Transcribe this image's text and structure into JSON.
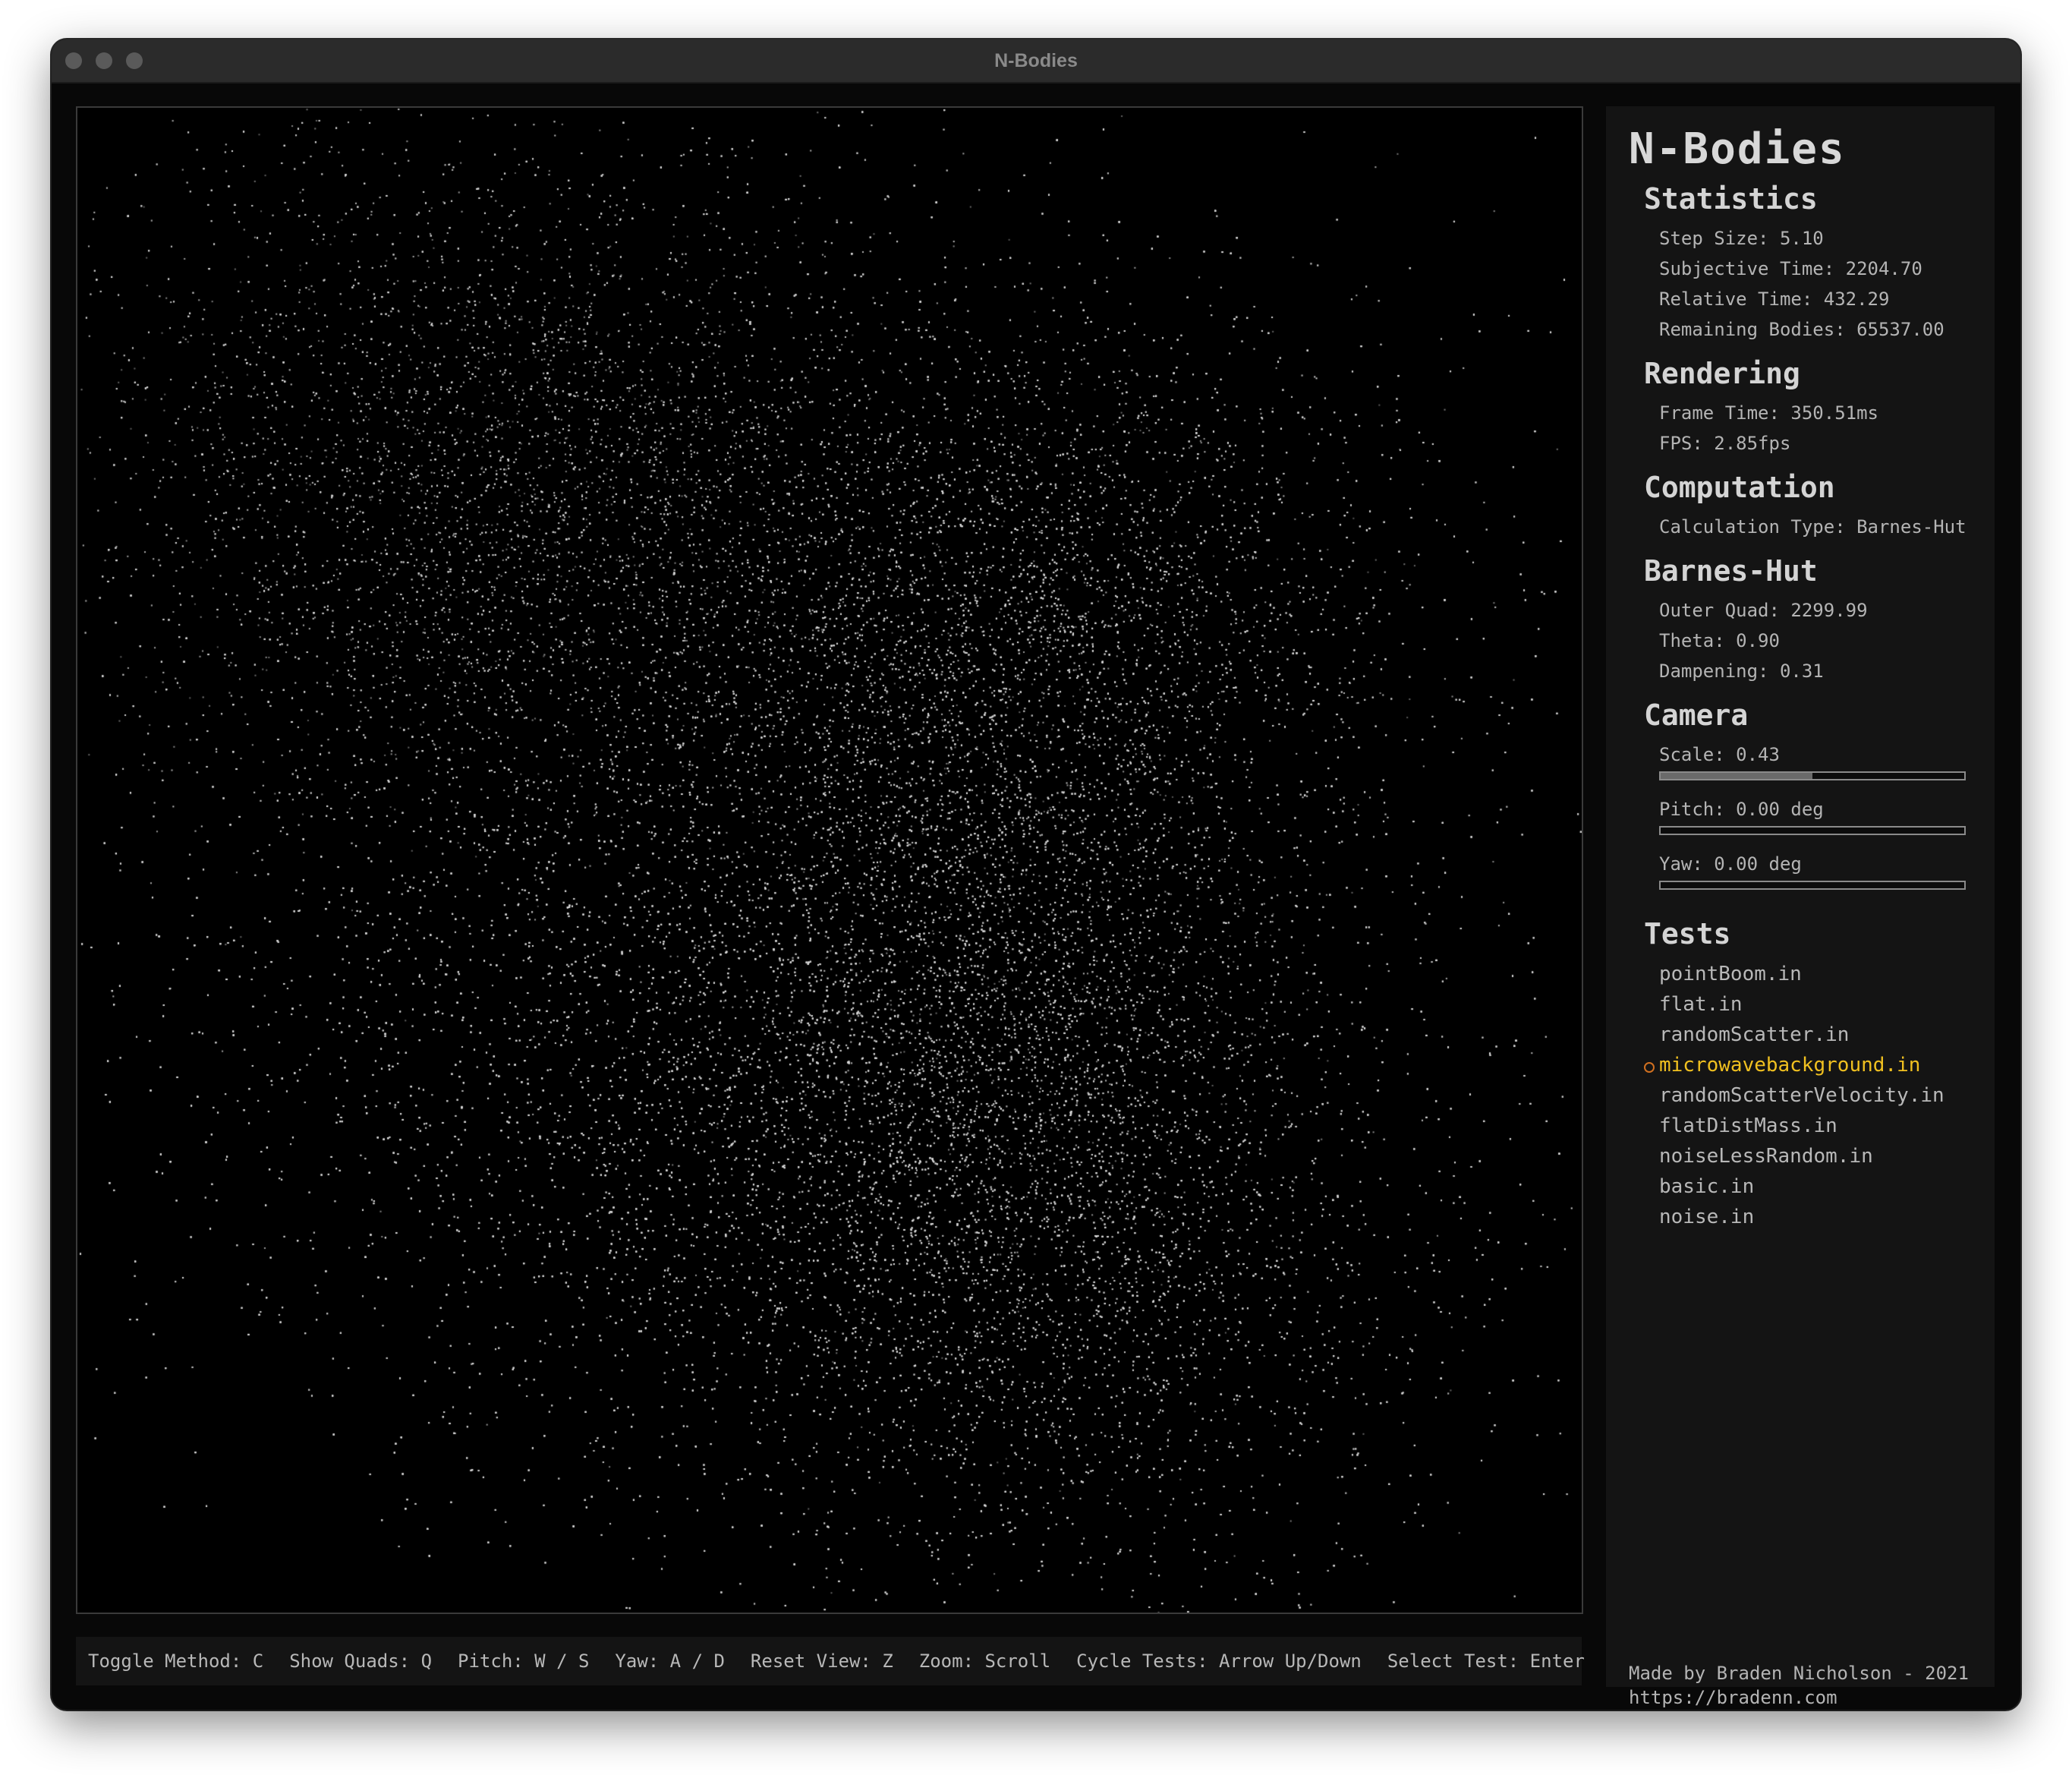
{
  "window": {
    "title": "N-Bodies"
  },
  "hotkeys": [
    "Toggle Method: C",
    "Show Quads: Q",
    "Pitch: W / S",
    "Yaw: A / D",
    "Reset View: Z",
    "Zoom: Scroll",
    "Cycle Tests: Arrow Up/Down",
    "Select Test: Enter"
  ],
  "sidebar": {
    "title": "N-Bodies",
    "statistics": {
      "heading": "Statistics",
      "step_size": "Step Size: 5.10",
      "subjective_time": "Subjective Time: 2204.70",
      "relative_time": "Relative Time: 432.29",
      "remaining_bodies": "Remaining Bodies: 65537.00"
    },
    "rendering": {
      "heading": "Rendering",
      "frame_time": "Frame Time: 350.51ms",
      "fps": "FPS: 2.85fps"
    },
    "computation": {
      "heading": "Computation",
      "calculation_type": "Calculation Type: Barnes-Hut"
    },
    "barnes_hut": {
      "heading": "Barnes-Hut",
      "outer_quad": "Outer Quad: 2299.99",
      "theta": "Theta: 0.90",
      "dampening": "Dampening: 0.31"
    },
    "camera": {
      "heading": "Camera",
      "scale_label": "Scale: 0.43",
      "scale_fraction": 0.5,
      "pitch_label": "Pitch: 0.00 deg",
      "pitch_fraction": 0,
      "yaw_label": "Yaw: 0.00 deg",
      "yaw_fraction": 0
    },
    "tests": {
      "heading": "Tests",
      "items": [
        "pointBoom.in",
        "flat.in",
        "randomScatter.in",
        "microwavebackground.in",
        "randomScatterVelocity.in",
        "flatDistMass.in",
        "noiseLessRandom.in",
        "basic.in",
        "noise.in"
      ],
      "selected_index": 3
    },
    "credits": {
      "line1": "Made by Braden Nicholson - 2021",
      "line2": "https://bradenn.com"
    }
  },
  "colors": {
    "background": "#000000",
    "panel": "#141414",
    "selected_test": "#f0c020",
    "selection_marker": "#d07020",
    "particles": "#d8d8d8"
  }
}
